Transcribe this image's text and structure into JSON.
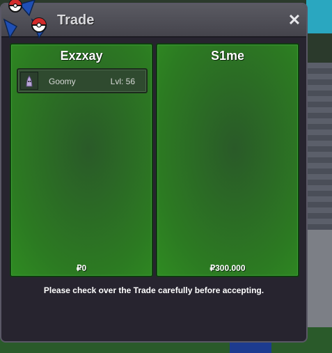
{
  "window": {
    "title": "Trade",
    "close_label": "✕"
  },
  "left_panel": {
    "player_name": "Exzxay",
    "items": [
      {
        "name": "Goomy",
        "level": "Lvl: 56"
      }
    ],
    "money": "₽0"
  },
  "right_panel": {
    "player_name": "S1me",
    "money": "₽300.000"
  },
  "notice": "Please check over the Trade carefully before accepting.",
  "colors": {
    "panel_green": "#2c7a22",
    "window_bg": "#27242f",
    "titlebar": "#4f4e56"
  },
  "icons": {
    "logo": "pokeball-logo-icon",
    "close": "close-icon",
    "item": "goomy-icon"
  }
}
